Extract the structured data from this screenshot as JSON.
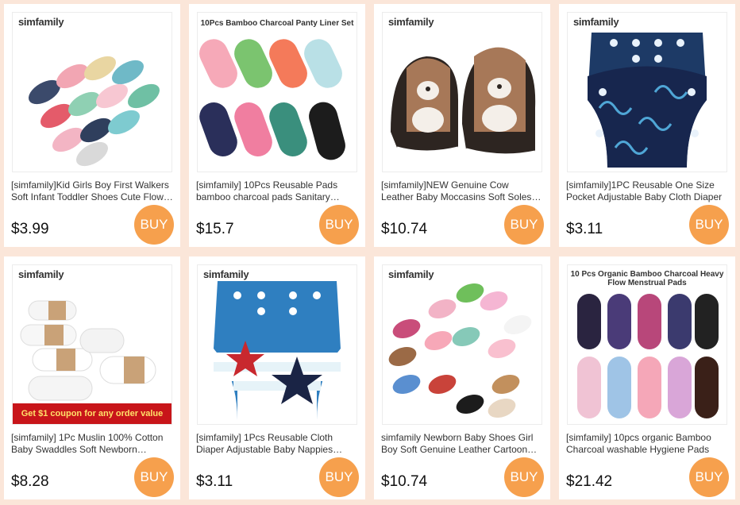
{
  "products": [
    {
      "brand": "simfamily",
      "banner_top": "",
      "banner_bottom": "",
      "title": "[simfamily]Kid Girls Boy First Walkers Soft Infant Toddler Shoes Cute Flower Soles Crib Shoes",
      "price": "$3.99",
      "buy": "BUY",
      "image_icon": "baby-shoes-image"
    },
    {
      "brand": "",
      "banner_top": "10Pcs Bamboo Charcoal Panty Liner Set",
      "banner_bottom": "",
      "title": "[simfamily] 10Pcs Reusable Pads bamboo charcoal pads Sanitary Napkin",
      "price": "$15.7",
      "buy": "BUY",
      "image_icon": "panty-liners-image"
    },
    {
      "brand": "simfamily",
      "banner_top": "",
      "banner_bottom": "",
      "title": "[simfamily]NEW Genuine Cow Leather Baby Moccasins Soft Soles Shoes",
      "price": "$10.74",
      "buy": "BUY",
      "image_icon": "leather-moccasins-image"
    },
    {
      "brand": "simfamily",
      "banner_top": "",
      "banner_bottom": "",
      "title": "[simfamily]1PC Reusable One Size Pocket Adjustable Baby Cloth Diaper",
      "price": "$3.11",
      "buy": "BUY",
      "image_icon": "cloth-diaper-image"
    },
    {
      "brand": "simfamily",
      "banner_top": "",
      "banner_bottom": "Get $1 coupon for any order value",
      "title": "[simfamily] 1Pc Muslin 100% Cotton Baby Swaddles Soft Newborn Blankets",
      "price": "$8.28",
      "buy": "BUY",
      "image_icon": "muslin-swaddles-image"
    },
    {
      "brand": "simfamily",
      "banner_top": "",
      "banner_bottom": "",
      "title": "[simfamily] 1Pcs Reusable Cloth Diaper Adjustable Baby Nappies Starfish",
      "price": "$3.11",
      "buy": "BUY",
      "image_icon": "starfish-diaper-image"
    },
    {
      "brand": "simfamily",
      "banner_top": "",
      "banner_bottom": "",
      "title": "simfamily Newborn Baby Shoes Girl Boy Soft Genuine Leather Cartoon Shoes",
      "price": "$10.74",
      "buy": "BUY",
      "image_icon": "cartoon-shoes-image"
    },
    {
      "brand": "",
      "banner_top": "10 Pcs Organic Bamboo Charcoal Heavy Flow Menstrual Pads",
      "banner_bottom": "",
      "title": "[simfamily] 10pcs organic Bamboo Charcoal washable Hygiene Pads",
      "price": "$21.42",
      "buy": "BUY",
      "image_icon": "menstrual-pads-image"
    }
  ],
  "colors": {
    "background": "#fbe6d9",
    "buy_button": "#f6a04d",
    "card": "#ffffff"
  }
}
